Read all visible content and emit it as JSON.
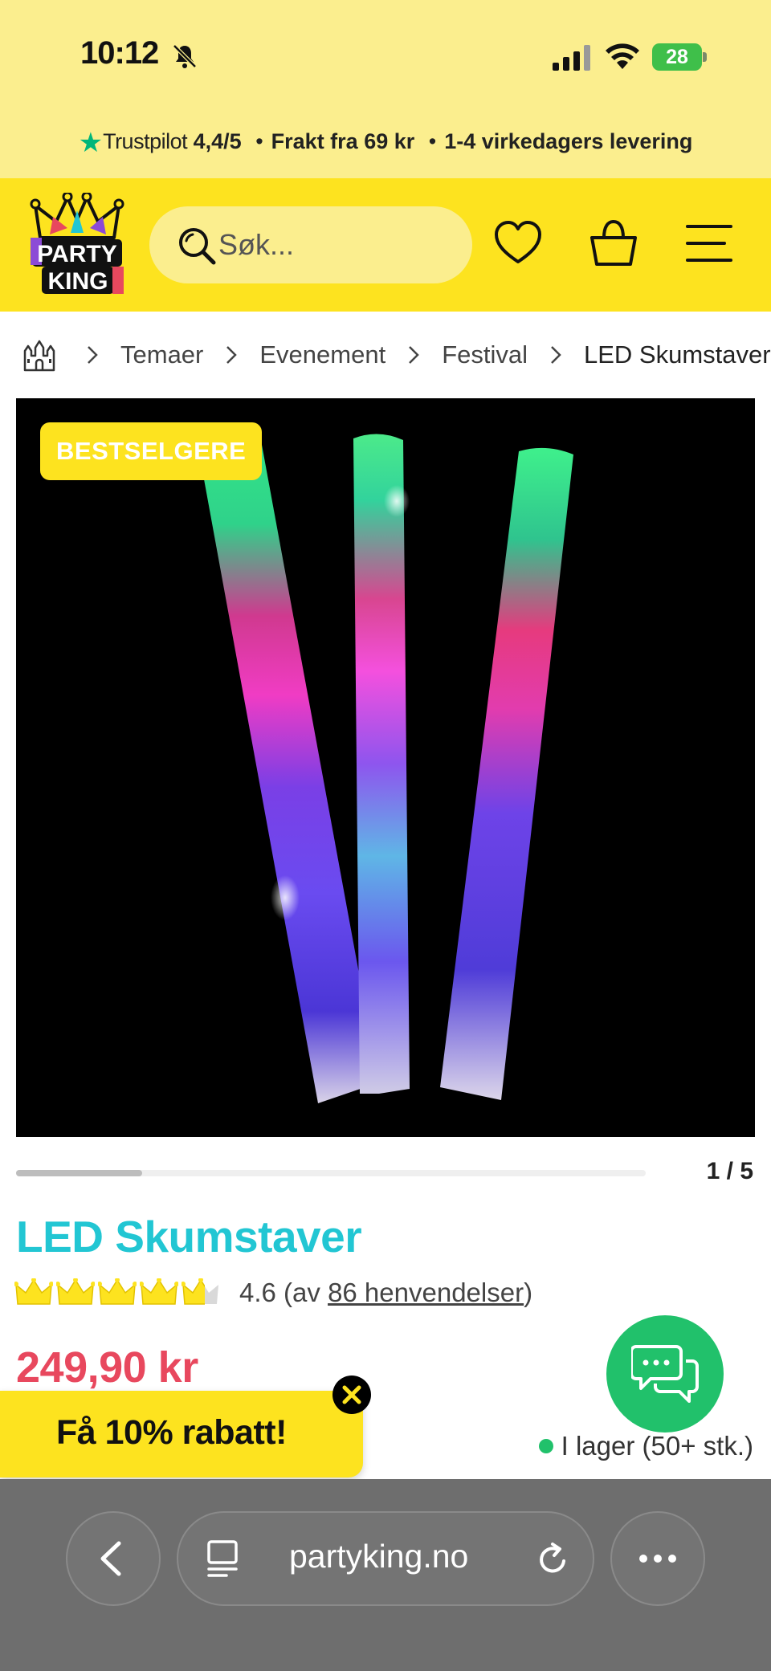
{
  "status_bar": {
    "time": "10:12",
    "battery": "28"
  },
  "trust_bar": {
    "brand": "Trustpilot",
    "rating": "4,4/5",
    "shipping": "Frakt fra 69 kr",
    "delivery": "1-4 virkedagers levering"
  },
  "header": {
    "logo_text_top": "PARTY",
    "logo_text_bottom": "KING",
    "search_placeholder": "Søk..."
  },
  "breadcrumb": {
    "items": [
      "Temaer",
      "Evenement",
      "Festival",
      "LED Skumstaver"
    ]
  },
  "product": {
    "badge": "BESTSELGERE",
    "gallery_counter": "1 / 5",
    "gallery_progress": 0.2,
    "title": "LED Skumstaver",
    "rating_value": "4.6",
    "rating_stars": 4.6,
    "rating_prefix": "(av",
    "rating_link": "86 henvendelser",
    "rating_suffix": ")",
    "price": "249,90 kr",
    "stock": "I lager (50+ stk.)"
  },
  "promo": {
    "label": "Få 10% rabatt!"
  },
  "browser": {
    "url": "partyking.no"
  },
  "colors": {
    "brand_yellow": "#fde31f",
    "title_cyan": "#22c6d3",
    "price_red": "#e8485e",
    "stock_green": "#21c16b",
    "trustpilot_green": "#00b67a"
  }
}
